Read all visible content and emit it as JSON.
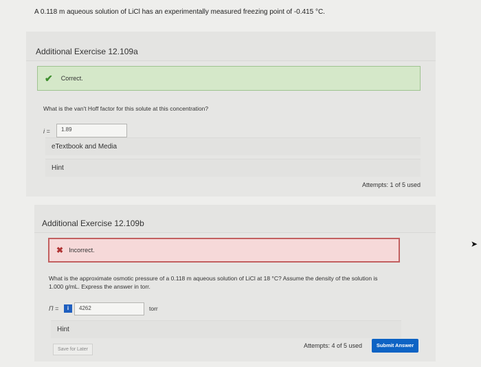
{
  "problem_statement": "A 0.118 m aqueous solution of LiCl has an experimentally measured freezing point of -0.415 °C.",
  "part_a": {
    "title": "Additional Exercise 12.109a",
    "feedback": "Correct.",
    "question": "What is the van't Hoff factor for this solute at this concentration?",
    "answer_label": "i =",
    "answer_value": "1.89",
    "etextbook_label": "eTextbook and Media",
    "hint_label": "Hint",
    "attempts": "Attempts: 1 of 5 used"
  },
  "part_b": {
    "title": "Additional Exercise 12.109b",
    "feedback": "Incorrect.",
    "question_line1": "What is the approximate osmotic pressure of a 0.118 m aqueous solution of LiCl at 18 °C? Assume the density of the solution is",
    "question_line2": "1.000 g/mL. Express the answer in torr.",
    "answer_label": "Π =",
    "info_glyph": "i",
    "answer_value": "4262",
    "unit": "torr",
    "hint_label": "Hint",
    "save_label": "Save for Later",
    "attempts": "Attempts: 4 of 5 used",
    "submit_label": "Submit Answer"
  },
  "colors": {
    "correct_bg": "#d5e8c9",
    "incorrect_border": "#c26060",
    "submit_bg": "#0d63c4"
  }
}
